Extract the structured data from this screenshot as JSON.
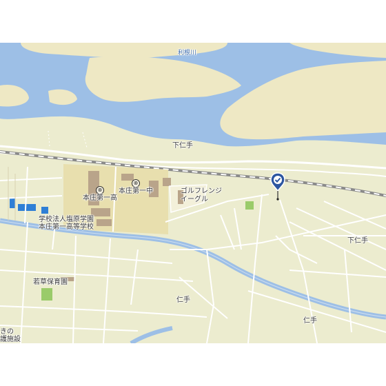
{
  "map": {
    "labels": {
      "river": "利根川",
      "shimonite_north": "下仁手",
      "shimonite_east": "下仁手",
      "nite_center": "仁手",
      "nite_south": "仁手",
      "honjo_daiichi_high": "本庄第一高",
      "honjo_daiichi_middle": "本庄第一中",
      "golf_line1": "ゴルフレンジ",
      "golf_line2": "イーグル",
      "gakuen_line1": "学校法人塩原学園",
      "gakuen_line2": "本庄第一高等学校",
      "wakakusa_nursery": "若草保育園",
      "partial_left_1": "きの",
      "partial_left_2": "護施設"
    },
    "icons": {
      "school": "school-icon",
      "marker": "location-pin-check-icon"
    },
    "colors": {
      "water": "#9dbfe6",
      "land": "#ececcf",
      "riverbank": "#eee8c4",
      "school_zone": "#e8dfae",
      "building": "#b9a48a",
      "park": "#9acb6a",
      "pin": "#2d56a0"
    }
  }
}
